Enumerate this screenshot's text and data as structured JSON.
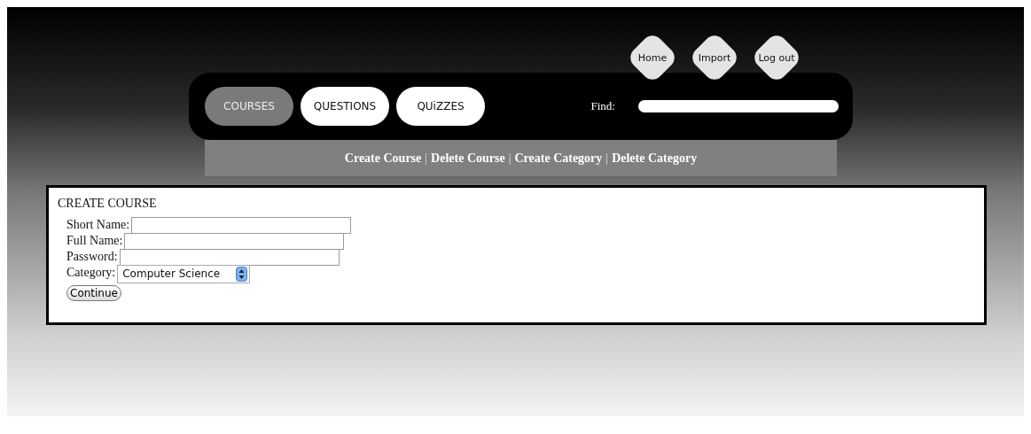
{
  "top_links": [
    {
      "label": "Home"
    },
    {
      "label": "Import"
    },
    {
      "label": "Log out"
    }
  ],
  "tabs": [
    {
      "label": "COURSES",
      "selected": true
    },
    {
      "label": "QUESTIONS",
      "selected": false
    },
    {
      "label": "QUiZZES",
      "selected": false
    }
  ],
  "find": {
    "label": "Find:"
  },
  "sub_menu": {
    "separator": "|",
    "links": [
      "Create Course",
      "Delete Course",
      "Create Category",
      "Delete Category"
    ]
  },
  "form": {
    "title": "CREATE COURSE",
    "fields": [
      {
        "kind": "text",
        "label": "Short Name:"
      },
      {
        "kind": "text",
        "label": "Full Name:"
      },
      {
        "kind": "text",
        "label": "Password:"
      },
      {
        "kind": "select",
        "label": "Category:",
        "value": "Computer Science"
      }
    ],
    "submit": "Continue"
  }
}
